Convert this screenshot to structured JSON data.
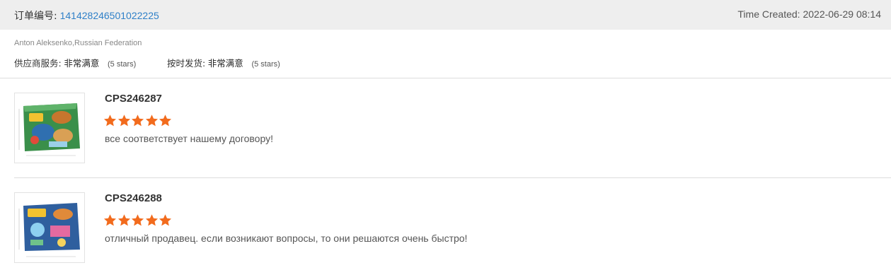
{
  "order": {
    "label": "订单编号:",
    "number": "141428246501022225",
    "time_created": "Time Created: 2022-06-29 08:14"
  },
  "buyer": "Anton Aleksenko,Russian Federation",
  "ratings": [
    {
      "label": "供应商服务:",
      "value": "非常满意",
      "note": "(5 stars)"
    },
    {
      "label": "按时发货:",
      "value": "非常满意",
      "note": "(5 stars)"
    }
  ],
  "colors": {
    "star": "#f26b1d",
    "link": "#2f80c8",
    "header_bg": "#eeeeee"
  },
  "items": [
    {
      "sku": "CPS246287",
      "rating": 5,
      "comment": "все соответствует нашему договору!",
      "image": "dinosaur-toy-box-thumbnail"
    },
    {
      "sku": "CPS246288",
      "rating": 5,
      "comment": "отличный продавец. если возникают вопросы, то они решаются очень быстро!",
      "image": "space-toy-box-thumbnail"
    }
  ]
}
